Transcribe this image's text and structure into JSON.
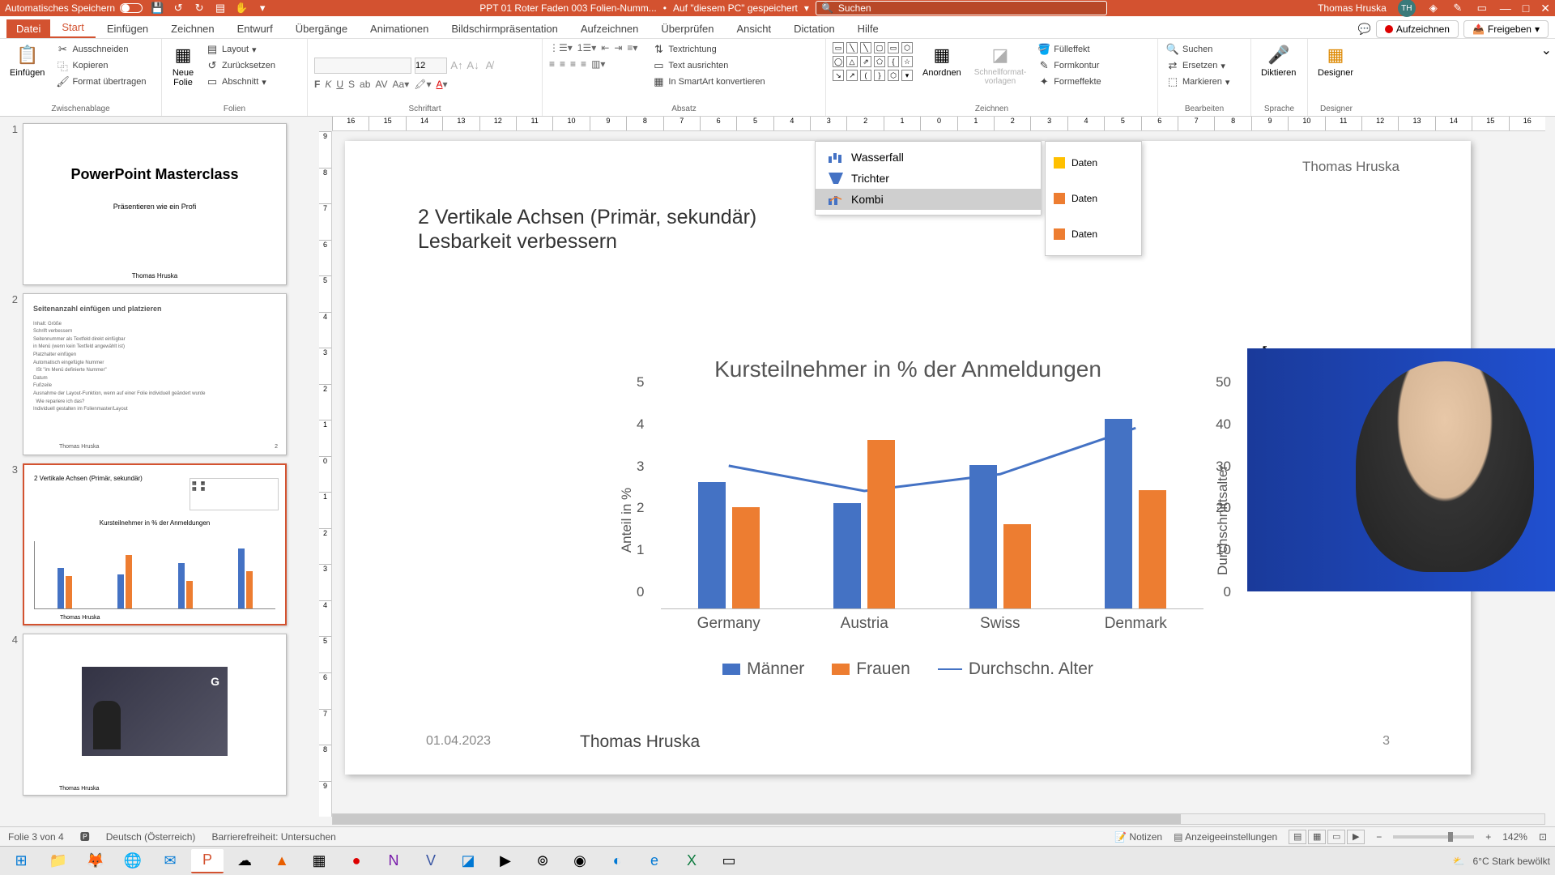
{
  "titlebar": {
    "autosave_label": "Automatisches Speichern",
    "doc_title": "PPT 01 Roter Faden 003 Folien-Numm...",
    "save_location": "Auf \"diesem PC\" gespeichert",
    "search_placeholder": "Suchen",
    "user_name": "Thomas Hruska",
    "user_initials": "TH"
  },
  "tabs": {
    "file": "Datei",
    "start": "Start",
    "einfuegen": "Einfügen",
    "zeichnen": "Zeichnen",
    "entwurf": "Entwurf",
    "uebergaenge": "Übergänge",
    "animationen": "Animationen",
    "bildschirm": "Bildschirmpräsentation",
    "aufzeichnen_tab": "Aufzeichnen",
    "ueberpruefen": "Überprüfen",
    "ansicht": "Ansicht",
    "dictation": "Dictation",
    "hilfe": "Hilfe",
    "aufzeichnen_btn": "Aufzeichnen",
    "freigeben": "Freigeben"
  },
  "ribbon": {
    "clipboard": {
      "label": "Zwischenablage",
      "paste": "Einfügen",
      "cut": "Ausschneiden",
      "copy": "Kopieren",
      "format": "Format übertragen"
    },
    "slides": {
      "label": "Folien",
      "new": "Neue\nFolie",
      "layout": "Layout",
      "reset": "Zurücksetzen",
      "section": "Abschnitt"
    },
    "font": {
      "label": "Schriftart",
      "size": "12"
    },
    "paragraph": {
      "label": "Absatz",
      "textdir": "Textrichtung",
      "textalign": "Text ausrichten",
      "smartart": "In SmartArt konvertieren"
    },
    "drawing": {
      "label": "Zeichnen",
      "arrange": "Anordnen",
      "quick": "Schnellformat-\nvorlagen",
      "fill": "Fülleffekt",
      "outline": "Formkontur",
      "effects": "Formeffekte"
    },
    "editing": {
      "label": "Bearbeiten",
      "find": "Suchen",
      "replace": "Ersetzen",
      "select": "Markieren"
    },
    "voice": {
      "label": "Sprache",
      "dictate": "Diktieren"
    },
    "designer": {
      "label": "Designer",
      "designer": "Designer"
    }
  },
  "thumbs": {
    "n1": "1",
    "n2": "2",
    "n3": "3",
    "n4": "4",
    "t1_title": "PowerPoint Masterclass",
    "t1_sub": "Präsentieren wie ein Profi",
    "t1_author": "Thomas Hruska",
    "t2_title": "Seitenanzahl einfügen und platzieren",
    "t3_title": "2 Vertikale Achsen (Primär, sekundär)",
    "t3_chart": "Kursteilnehmer in % der Anmeldungen",
    "footer_author": "Thomas Hruska"
  },
  "slide": {
    "author": "Thomas Hruska",
    "title_l1": "2 Vertikale Achsen (Primär, sekundär)",
    "title_l2": "Lesbarkeit verbessern",
    "popup": {
      "wasserfall": "Wasserfall",
      "trichter": "Trichter",
      "kombi": "Kombi"
    },
    "legend_popup": {
      "r1": "Daten",
      "r2": "Daten",
      "r3": "Daten"
    },
    "footer_date": "01.04.2023",
    "footer_name": "Thomas Hruska",
    "footer_num": "3"
  },
  "chart_data": {
    "type": "bar",
    "title": "Kursteilnehmer in % der Anmeldungen",
    "categories": [
      "Germany",
      "Austria",
      "Swiss",
      "Denmark"
    ],
    "series": [
      {
        "name": "Männer",
        "values": [
          3.0,
          2.5,
          3.4,
          4.5
        ]
      },
      {
        "name": "Frauen",
        "values": [
          2.4,
          4.0,
          2.0,
          2.8
        ]
      }
    ],
    "line_series": {
      "name": "Durchschn. Alter",
      "values": [
        34,
        28,
        32,
        43
      ],
      "axis": "secondary"
    },
    "ylabel": "Anteil in %",
    "y2label": "Durchschnittsalter",
    "ylim": [
      0,
      5
    ],
    "y2lim": [
      0,
      50
    ],
    "yticks": [
      0,
      1,
      2,
      3,
      4,
      5
    ],
    "y2ticks": [
      0,
      10,
      20,
      30,
      40,
      50
    ],
    "legend": [
      "Männer",
      "Frauen",
      "Durchschn. Alter"
    ]
  },
  "statusbar": {
    "slide_info": "Folie 3 von 4",
    "lang": "Deutsch (Österreich)",
    "access": "Barrierefreiheit: Untersuchen",
    "notes": "Notizen",
    "display": "Anzeigeeinstellungen",
    "zoom": "142%"
  },
  "taskbar": {
    "weather": "6°C  Stark bewölkt"
  },
  "ruler": {
    "h": [
      "16",
      "15",
      "14",
      "13",
      "12",
      "11",
      "10",
      "9",
      "8",
      "7",
      "6",
      "5",
      "4",
      "3",
      "2",
      "1",
      "0",
      "1",
      "2",
      "3",
      "4",
      "5",
      "6",
      "7",
      "8",
      "9",
      "10",
      "11",
      "12",
      "13",
      "14",
      "15",
      "16"
    ],
    "v": [
      "9",
      "8",
      "7",
      "6",
      "5",
      "4",
      "3",
      "2",
      "1",
      "0",
      "1",
      "2",
      "3",
      "4",
      "5",
      "6",
      "7",
      "8",
      "9"
    ]
  }
}
